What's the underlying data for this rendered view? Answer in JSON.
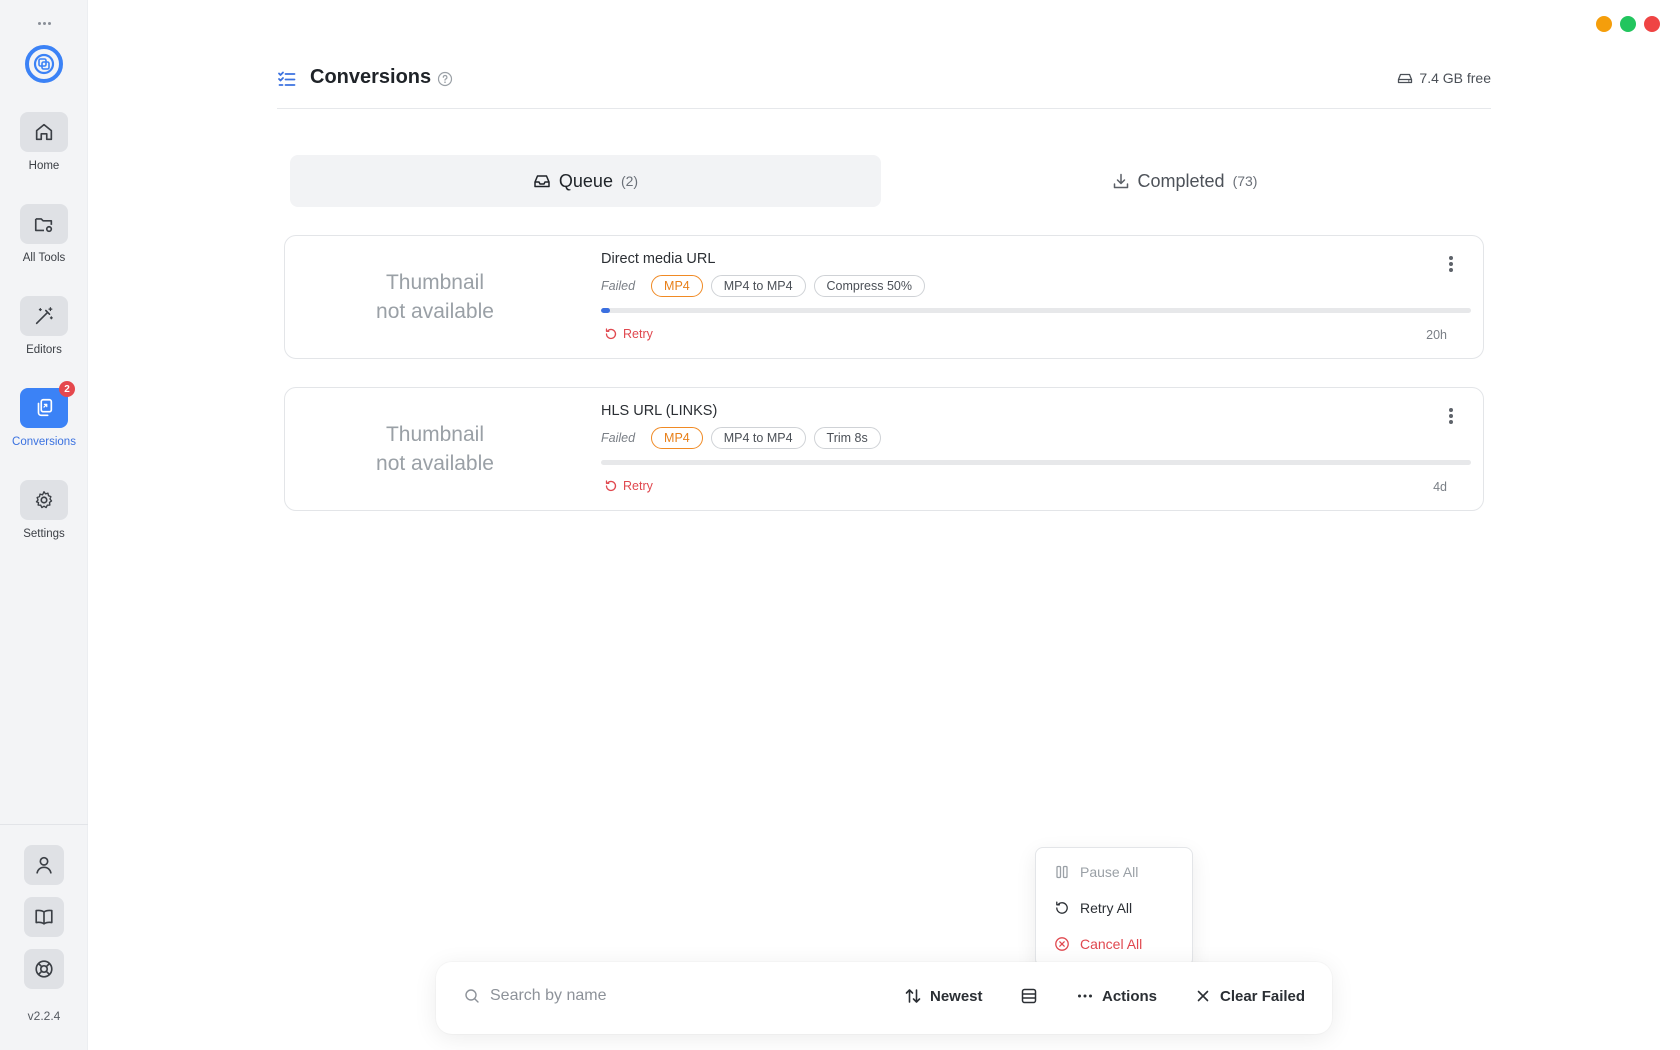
{
  "app": {
    "version": "v2.2.4"
  },
  "window_controls": [
    {
      "name": "minimize",
      "color": "#f59e0b"
    },
    {
      "name": "maximize",
      "color": "#22c55e"
    },
    {
      "name": "close",
      "color": "#ef4444"
    }
  ],
  "sidebar": {
    "items": [
      {
        "label": "Home",
        "icon": "home-icon"
      },
      {
        "label": "All Tools",
        "icon": "folder-gear-icon"
      },
      {
        "label": "Editors",
        "icon": "magic-wand-icon"
      },
      {
        "label": "Conversions",
        "icon": "conversions-icon",
        "badge": "2",
        "active": true
      },
      {
        "label": "Settings",
        "icon": "gear-icon"
      }
    ],
    "footer": [
      "user-icon",
      "book-icon",
      "lifebuoy-icon"
    ]
  },
  "header": {
    "title": "Conversions",
    "storage": "7.4 GB free"
  },
  "tabs": [
    {
      "label": "Queue",
      "count": "(2)",
      "icon": "inbox-icon",
      "active": true
    },
    {
      "label": "Completed",
      "count": "(73)",
      "icon": "download-icon",
      "active": false
    }
  ],
  "queue": [
    {
      "title": "Direct media URL",
      "thumbnail_line1": "Thumbnail",
      "thumbnail_line2": "not available",
      "status": "Failed",
      "format": "MP4",
      "chips": [
        "MP4 to MP4",
        "Compress 50%"
      ],
      "progress": 0.01,
      "retry_label": "Retry",
      "age": "20h"
    },
    {
      "title": "HLS URL (LINKS)",
      "thumbnail_line1": "Thumbnail",
      "thumbnail_line2": "not available",
      "status": "Failed",
      "format": "MP4",
      "chips": [
        "MP4 to MP4",
        "Trim 8s"
      ],
      "progress": 0,
      "retry_label": "Retry",
      "age": "4d"
    }
  ],
  "actions_menu": {
    "items": [
      {
        "label": "Pause All",
        "icon": "pause-icon",
        "state": "disabled"
      },
      {
        "label": "Retry All",
        "icon": "retry-icon",
        "state": "normal"
      },
      {
        "label": "Cancel All",
        "icon": "cancel-circle-icon",
        "state": "danger"
      }
    ]
  },
  "toolbar": {
    "search_placeholder": "Search by name",
    "sort_label": "Newest",
    "actions_label": "Actions",
    "clear_label": "Clear Failed"
  },
  "colors": {
    "accent": "#3b82f6",
    "danger": "#e0484f",
    "format_chip": "#f08a24"
  }
}
